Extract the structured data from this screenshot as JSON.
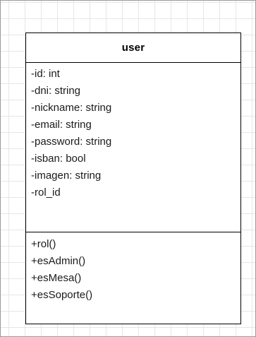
{
  "uml_class": {
    "name": "user",
    "attributes": [
      "-id: int",
      "-dni: string",
      "-nickname: string",
      "-email: string",
      "-password: string",
      "-isban: bool",
      "-imagen: string",
      "-rol_id"
    ],
    "methods": [
      "+rol()",
      "+esAdmin()",
      "+esMesa()",
      "+esSoporte()"
    ]
  }
}
